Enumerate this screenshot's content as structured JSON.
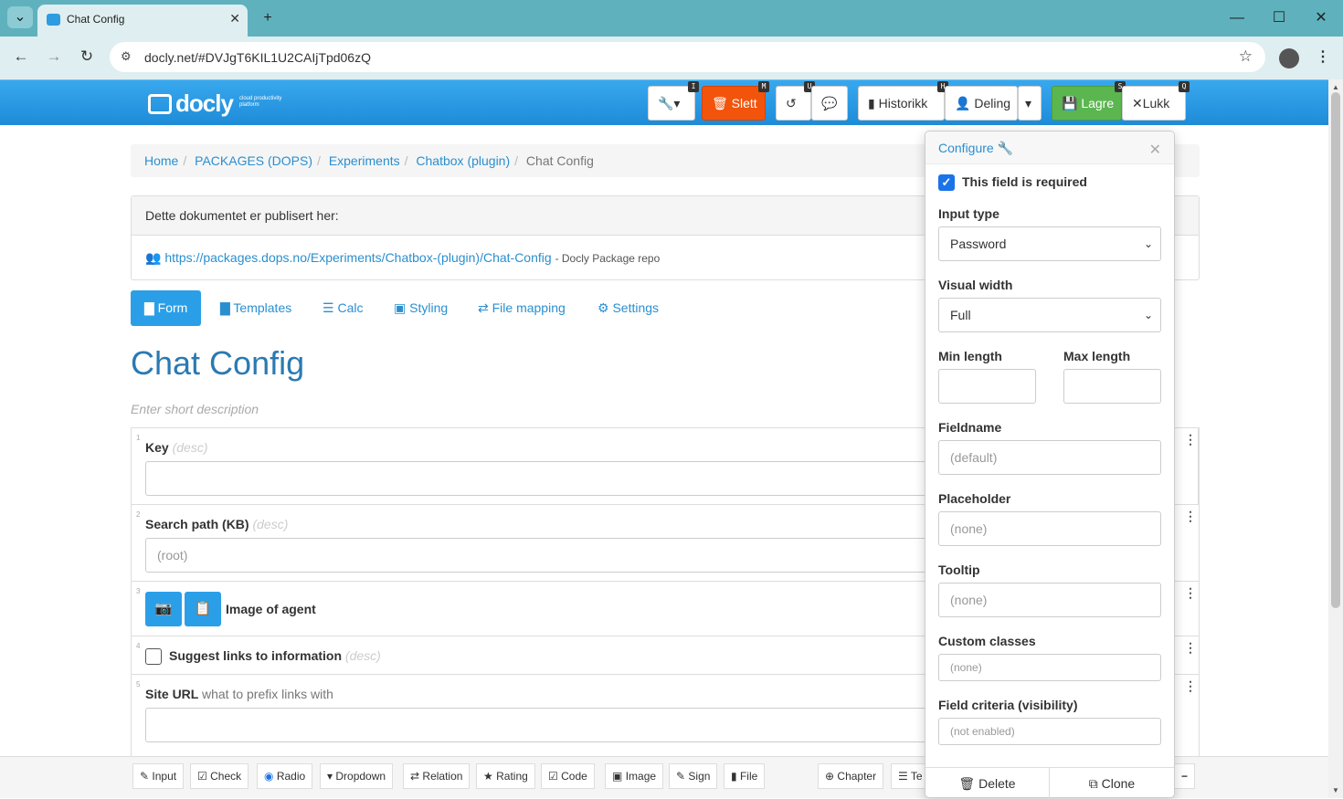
{
  "browser": {
    "tab_title": "Chat Config",
    "url": "docly.net/#DVJgT6KIL1U2CAIjTpd06zQ"
  },
  "header": {
    "logo_text": "docly",
    "logo_sub": "cloud productivity platform",
    "buttons": {
      "tools_key": "I",
      "delete_label": "Slett",
      "delete_key": "M",
      "undo_key": "U",
      "history_label": "Historikk",
      "history_key": "H",
      "share_label": "Deling",
      "save_label": "Lagre",
      "save_key": "S",
      "close_label": "Lukk",
      "close_key": "Q"
    },
    "colors": {
      "delete": "#f2540c",
      "save": "#5bb64f",
      "accent": "#2a9fe8"
    }
  },
  "breadcrumb": {
    "items": [
      "Home",
      "PACKAGES (DOPS)",
      "Experiments",
      "Chatbox (plugin)"
    ],
    "current": "Chat Config"
  },
  "published": {
    "heading": "Dette dokumentet er publisert her:",
    "link": "https://packages.dops.no/Experiments/Chatbox-(plugin)/Chat-Config",
    "note": "- Docly Package repo"
  },
  "tabs": [
    "Form",
    "Templates",
    "Calc",
    "Styling",
    "File mapping",
    "Settings"
  ],
  "document": {
    "title": "Chat Config",
    "short_desc_placeholder": "Enter short description"
  },
  "fields": [
    {
      "num": "1",
      "label": "Key",
      "desc": "(desc)"
    },
    {
      "num": "2",
      "label": "Search path (KB)",
      "desc": "(desc)",
      "placeholder": "(root)"
    },
    {
      "num": "3",
      "label": "Image of agent"
    },
    {
      "num": "4",
      "label": "Suggest links to information",
      "desc": "(desc)"
    },
    {
      "num": "5",
      "label": "Site URL",
      "desc": "what to prefix links with"
    }
  ],
  "toolbar": {
    "items": [
      "Input",
      "Check",
      "Radio",
      "Dropdown",
      "Relation",
      "Rating",
      "Code",
      "Image",
      "Sign",
      "File",
      "Chapter",
      "Te"
    ],
    "collapse": "−"
  },
  "configure": {
    "title": "Configure",
    "required_label": "This field is required",
    "required_checked": true,
    "input_type_label": "Input type",
    "input_type_value": "Password",
    "visual_width_label": "Visual width",
    "visual_width_value": "Full",
    "min_length_label": "Min length",
    "max_length_label": "Max length",
    "fieldname_label": "Fieldname",
    "fieldname_placeholder": "(default)",
    "placeholder_label": "Placeholder",
    "placeholder_placeholder": "(none)",
    "tooltip_label": "Tooltip",
    "tooltip_placeholder": "(none)",
    "classes_label": "Custom classes",
    "classes_placeholder": "(none)",
    "criteria_label": "Field criteria (visibility)",
    "criteria_placeholder": "(not enabled)",
    "delete_label": "Delete",
    "clone_label": "Clone"
  }
}
